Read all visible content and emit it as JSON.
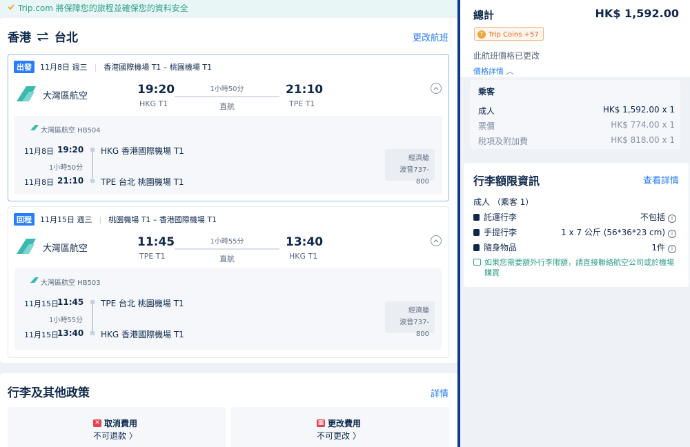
{
  "banner": {
    "text": "Trip.com 將保障您的旅程並確保您的資料安全"
  },
  "route": {
    "from": "香港",
    "to": "台北",
    "swap_icon": "swap-arrows-icon",
    "change_link": "更改航班"
  },
  "outbound": {
    "tag": "出發",
    "date": "11月8日 週三",
    "route_text": "香港國際機場 T1 – 桃園機場 T1",
    "airline": "大灣區航空",
    "dep_time": "19:20",
    "dep_airport": "HKG T1",
    "duration": "1小時50分",
    "stop_type": "直航",
    "arr_time": "21:10",
    "arr_airport": "TPE T1",
    "detail": {
      "flight": "大灣區航空 HB504",
      "dep_date": "11月8日",
      "dep_time": "19:20",
      "dep_port": "HKG 香港國際機場 T1",
      "duration": "1小時50分",
      "arr_date": "11月8日",
      "arr_time": "21:10",
      "arr_port": "TPE 台北 桃園機場 T1",
      "cabin": "經濟艙",
      "aircraft": "波音737-800"
    }
  },
  "return": {
    "tag": "回程",
    "date": "11月15日 週三",
    "route_text": "桃園機場 T1 – 香港國際機場 T1",
    "airline": "大灣區航空",
    "dep_time": "11:45",
    "dep_airport": "TPE T1",
    "duration": "1小時55分",
    "stop_type": "直航",
    "arr_time": "13:40",
    "arr_airport": "HKG T1",
    "detail": {
      "flight": "大灣區航空 HB503",
      "dep_date": "11月15日",
      "dep_time": "11:45",
      "dep_port": "TPE 台北 桃園機場 T1",
      "duration": "1小時55分",
      "arr_date": "11月15日",
      "arr_time": "13:40",
      "arr_port": "HKG 香港國際機場 T1",
      "cabin": "經濟艙",
      "aircraft": "波音737-800"
    }
  },
  "policy": {
    "title": "行李及其他政策",
    "link": "詳情",
    "cancel": {
      "title": "取消費用",
      "value": "不可退款 〉"
    },
    "change": {
      "title": "更改費用",
      "value": "不可更改 〉"
    }
  },
  "summary": {
    "total_label": "總計",
    "total_value": "HK$ 1,592.00",
    "coins": "Trip Coins +57",
    "price_changed": "此航班價格已更改",
    "price_detail": "價格詳情 ︿",
    "pax_title": "乘客",
    "adult_label": "成人",
    "adult_value": "HK$ 1,592.00 x 1",
    "fare_label": "票價",
    "fare_value": "HK$ 774.00 x 1",
    "tax_label": "稅項及附加費",
    "tax_value": "HK$ 818.00 x 1"
  },
  "baggage": {
    "title": "行李額限資訊",
    "link": "查看詳情",
    "pax": "成人 （乘客 1）",
    "checked_label": "託運行李",
    "checked_value": "不包括",
    "carry_label": "手提行李",
    "carry_value": "1 x 7 公斤 (56*36*23 cm)",
    "personal_label": "隨身物品",
    "personal_value": "1件",
    "note": "如果您需要額外行李限額，請直接聯絡航空公司或於機場購買"
  },
  "colors": {
    "accent": "#287dfa",
    "navy": "#0f294d",
    "green": "#2e9c87",
    "red": "#e6424d"
  }
}
